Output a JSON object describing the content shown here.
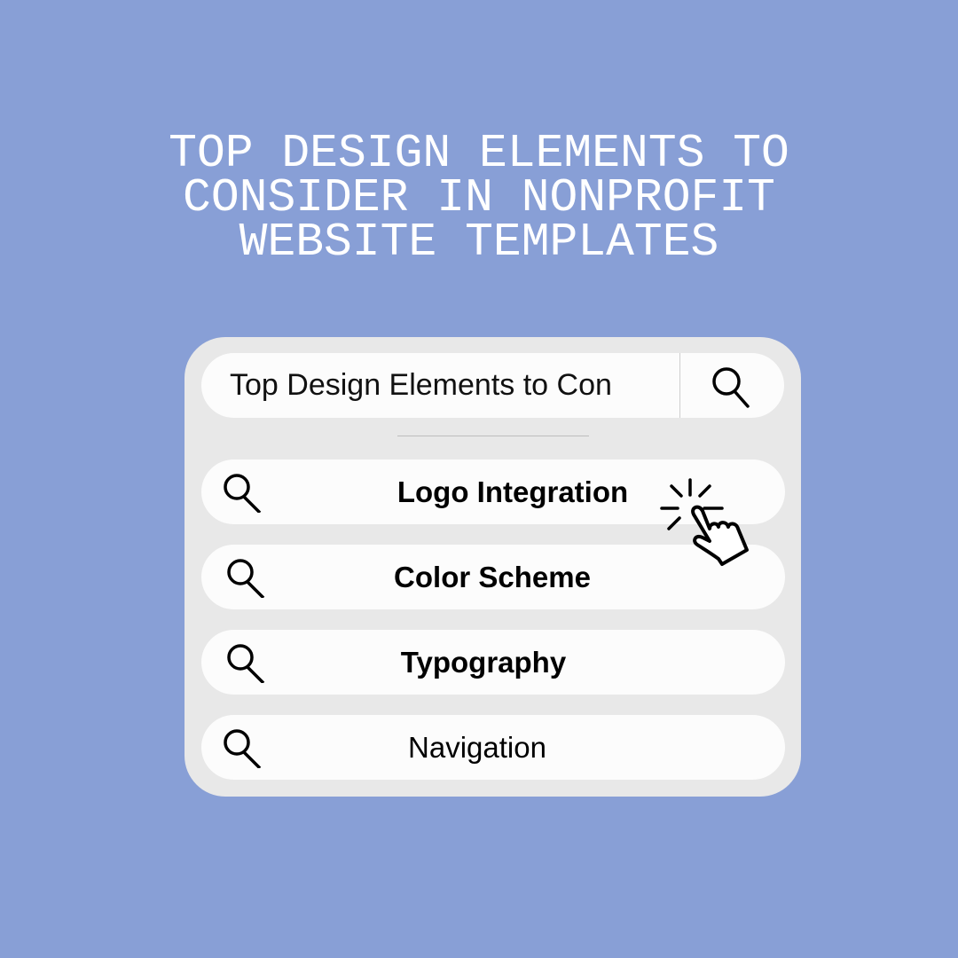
{
  "title": {
    "lines": [
      "TOP DESIGN ELEMENTS TO",
      "CONSIDER IN NONPROFIT",
      "WEBSITE TEMPLATES"
    ]
  },
  "search": {
    "query": "Top Design Elements to Con",
    "button_icon": "search-icon"
  },
  "results": [
    {
      "label": "Logo Integration",
      "icon": "search-icon"
    },
    {
      "label": "Color Scheme",
      "icon": "search-icon"
    },
    {
      "label": "Typography",
      "icon": "search-icon"
    },
    {
      "label": "Navigation",
      "icon": "search-icon"
    }
  ],
  "cursor_icon": "hand-pointer-click-icon",
  "colors": {
    "background": "#889fd6",
    "card": "#e8e8e8",
    "field": "#fcfcfc",
    "text": "#000000",
    "title": "#ffffff"
  }
}
